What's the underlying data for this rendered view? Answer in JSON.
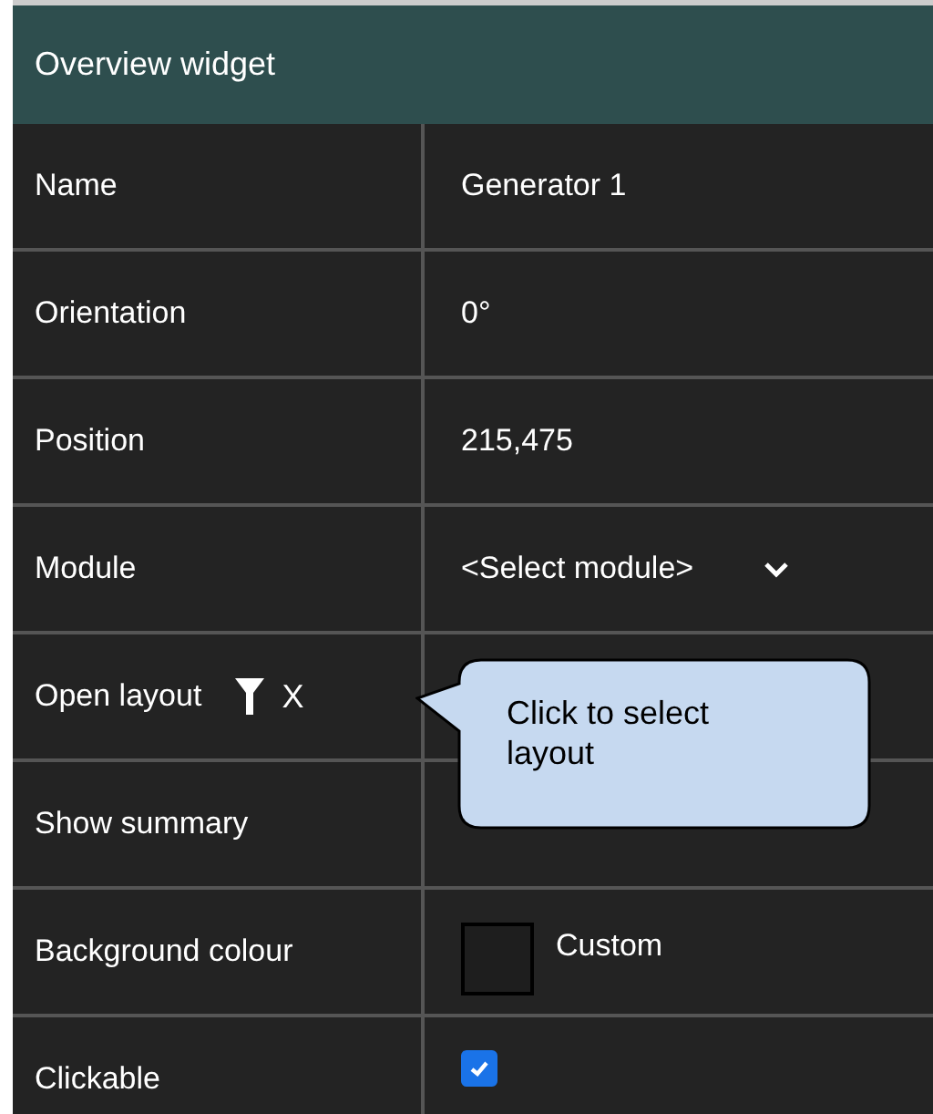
{
  "panel": {
    "title": "Overview widget"
  },
  "rows": [
    {
      "kind": "text",
      "label": "Name",
      "value": "Generator 1"
    },
    {
      "kind": "text",
      "label": "Orientation",
      "value": "0°"
    },
    {
      "kind": "text",
      "label": "Position",
      "value": "215,475"
    },
    {
      "kind": "select",
      "label": "Module",
      "value": "<Select module>"
    },
    {
      "kind": "layout",
      "label": "Open layout",
      "clear": "X"
    },
    {
      "kind": "empty",
      "label": "Show summary"
    },
    {
      "kind": "colour",
      "label": "Background colour",
      "value": "Custom",
      "color": "#1e1e1e"
    },
    {
      "kind": "checkbox",
      "label": "Clickable",
      "checked": true
    }
  ],
  "callout": {
    "text": "Click to select layout"
  }
}
